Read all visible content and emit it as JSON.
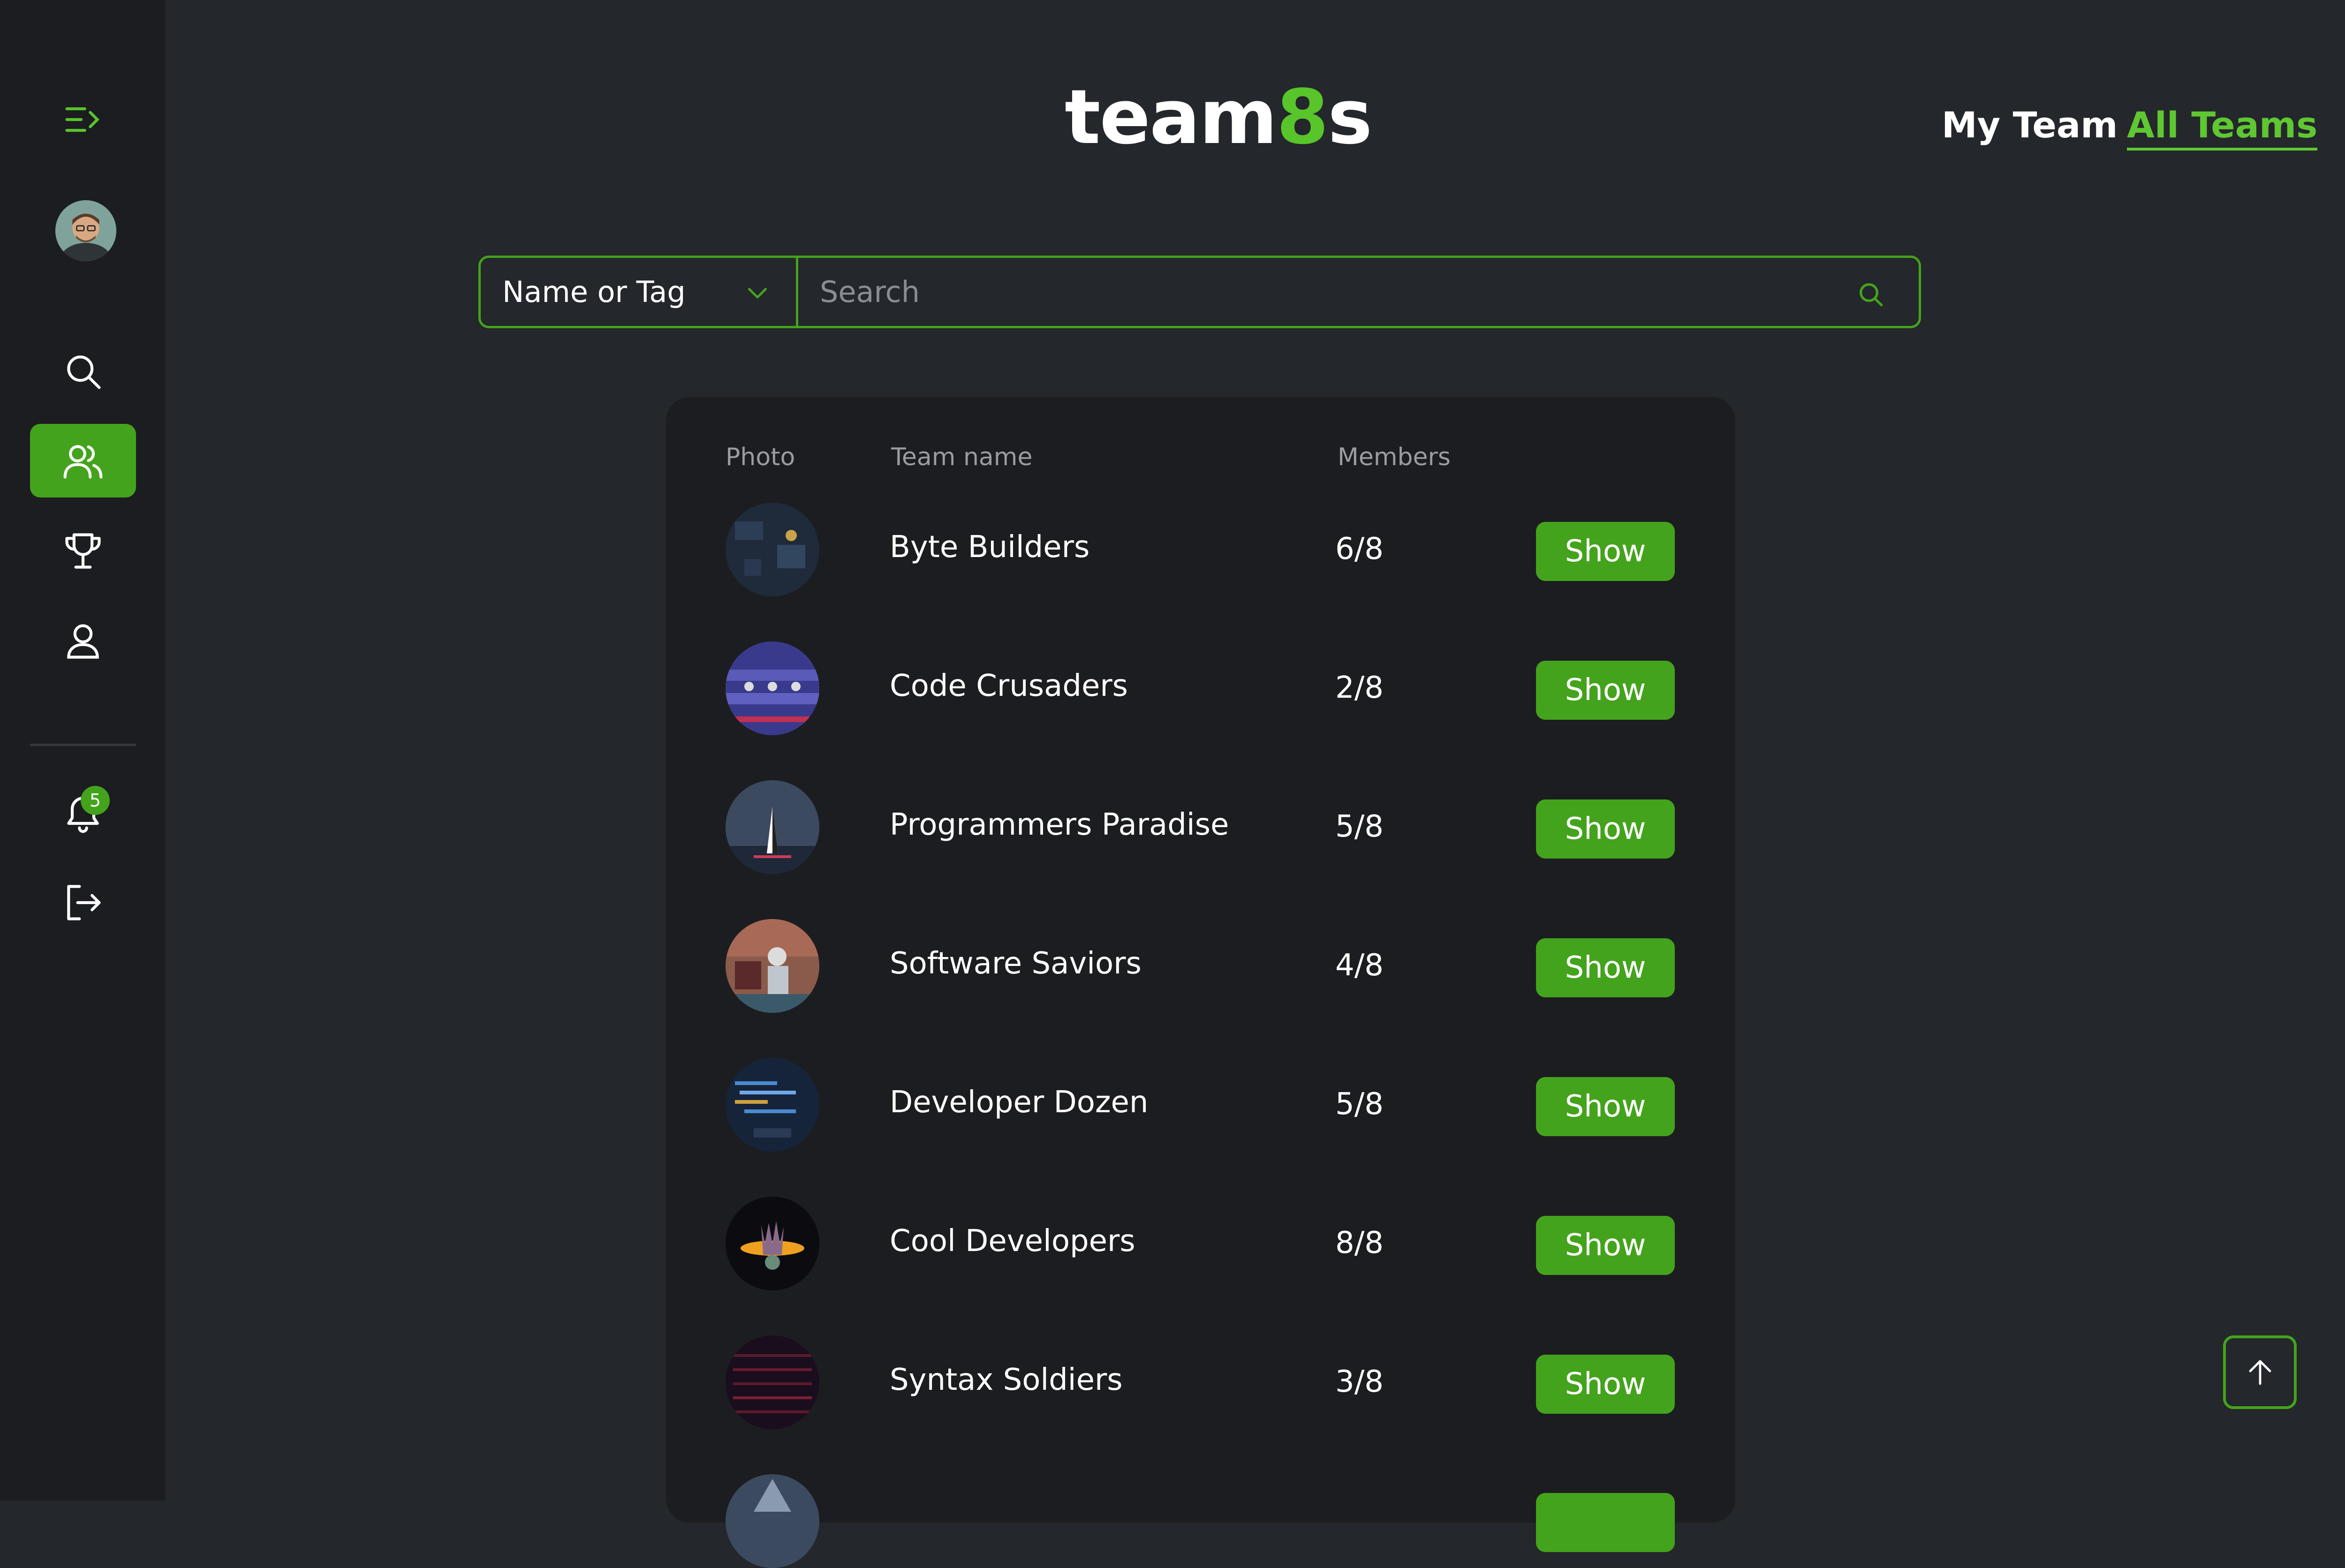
{
  "app": {
    "logo_prefix": "team",
    "logo_accent": "8",
    "logo_suffix": "s"
  },
  "nav": {
    "my_team": "My Team",
    "all_teams": "All Teams"
  },
  "sidebar": {
    "notifications_count": "5",
    "items": [
      "menu-toggle",
      "search",
      "teams",
      "trophy",
      "profile",
      "notifications",
      "logout"
    ]
  },
  "search": {
    "filter_value": "Name or Tag",
    "placeholder": "Search"
  },
  "table": {
    "headers": {
      "photo": "Photo",
      "name": "Team name",
      "members": "Members"
    },
    "show_label": "Show",
    "rows": [
      {
        "name": "Byte Builders",
        "members": "6/8"
      },
      {
        "name": "Code Crusaders",
        "members": "2/8"
      },
      {
        "name": "Programmers Paradise",
        "members": "5/8"
      },
      {
        "name": "Software Saviors",
        "members": "4/8"
      },
      {
        "name": "Developer Dozen",
        "members": "5/8"
      },
      {
        "name": "Cool Developers",
        "members": "8/8"
      },
      {
        "name": "Syntax Soldiers",
        "members": "3/8"
      }
    ]
  },
  "colors": {
    "accent": "#44a31c",
    "accent_light": "#5ec732",
    "background": "#24272b",
    "sidebar": "#1c1d20"
  }
}
